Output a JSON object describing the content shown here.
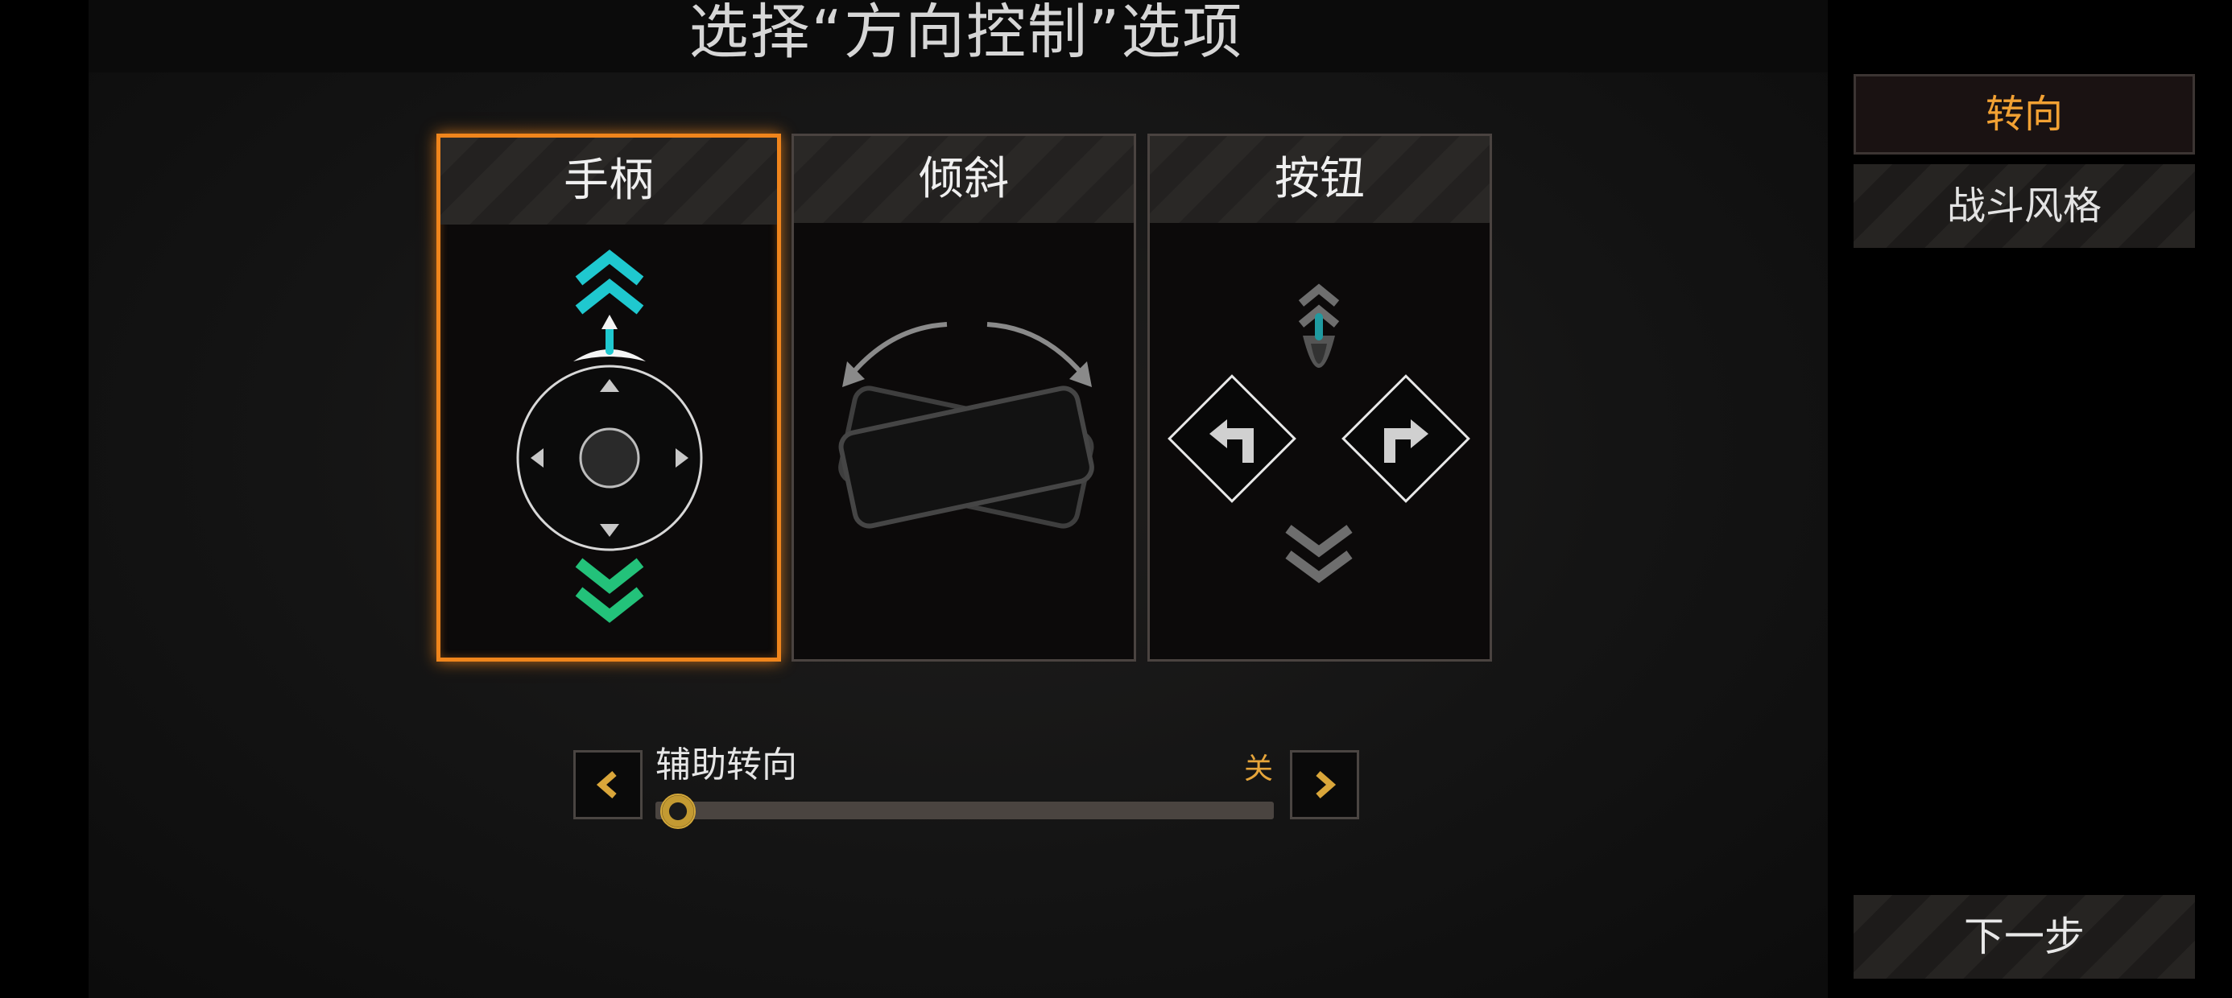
{
  "title": "选择“方向控制”选项",
  "options": [
    {
      "label": "手柄",
      "selected": true
    },
    {
      "label": "倾斜",
      "selected": false
    },
    {
      "label": "按钮",
      "selected": false
    }
  ],
  "assist": {
    "label": "辅助转向",
    "value": "关",
    "level": 0
  },
  "sidebar": {
    "steer": "转向",
    "style": "战斗风格",
    "next": "下一步"
  },
  "colors": {
    "accent": "#f0851c",
    "active_text": "#f2a133",
    "up_arrow": "#1fc8cf",
    "down_arrow": "#23c27a"
  },
  "icons": [
    "chevron-up-icon",
    "chevron-down-icon",
    "joystick-icon",
    "ship-icon",
    "tilt-phone-icon",
    "turn-left-icon",
    "turn-right-icon",
    "chevron-left-icon",
    "chevron-right-icon"
  ]
}
